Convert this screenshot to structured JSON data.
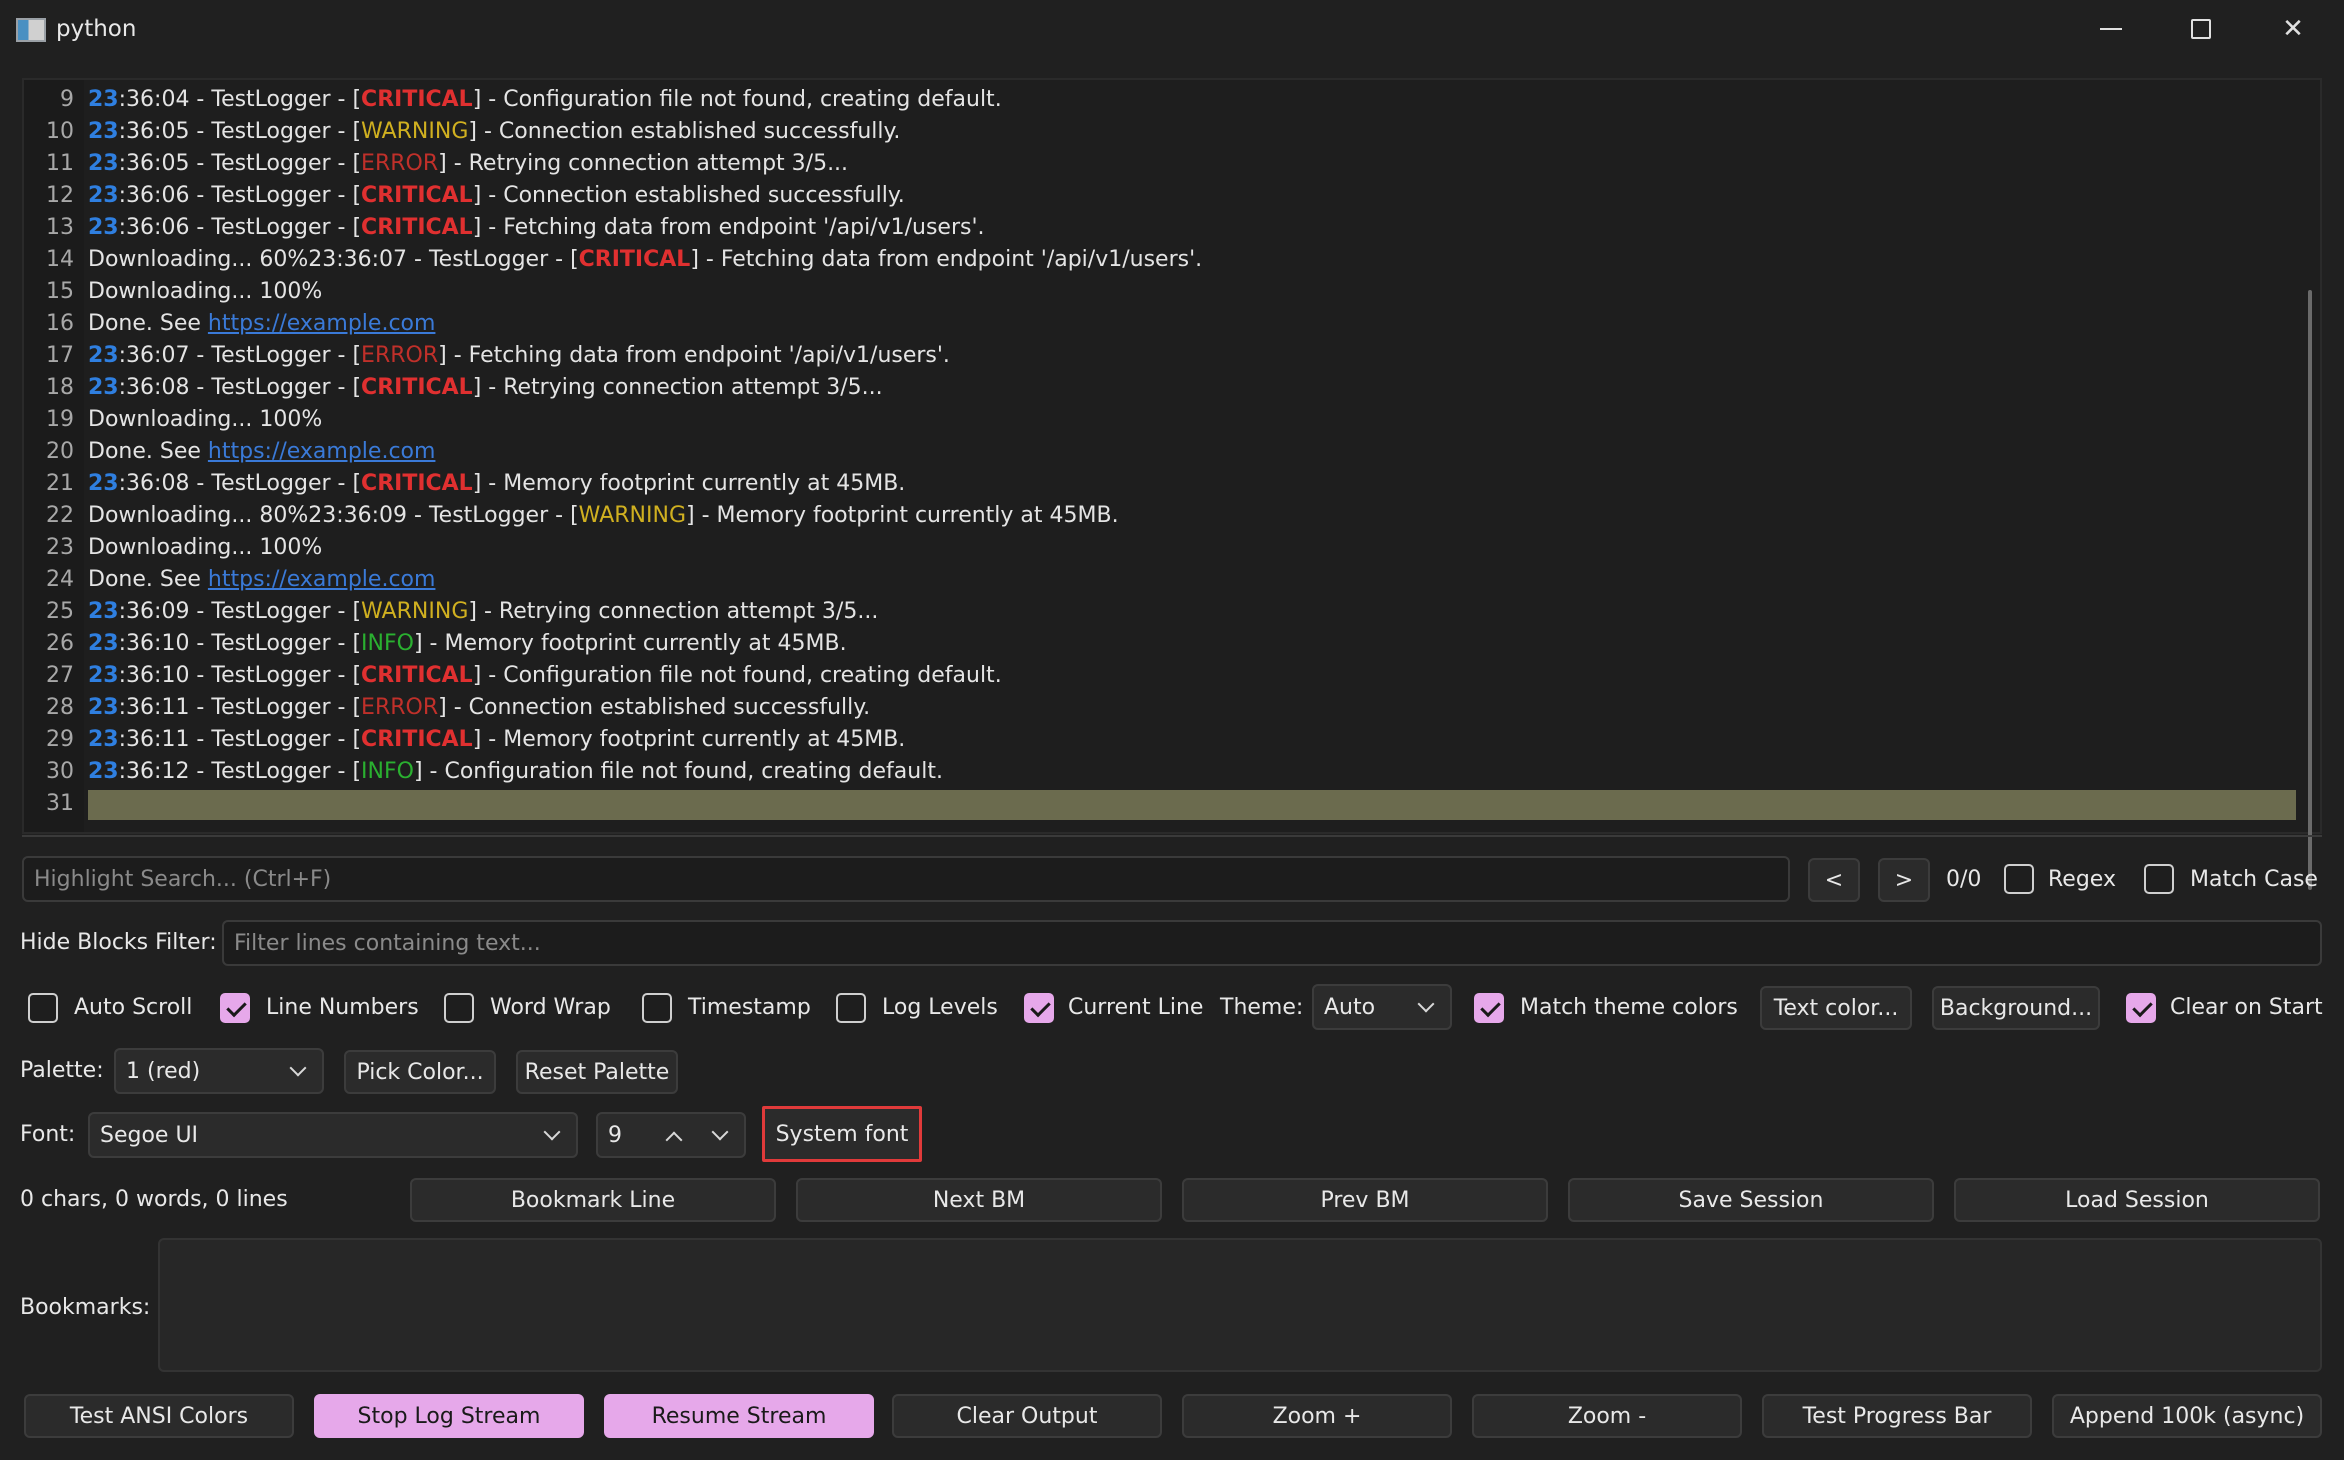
{
  "window": {
    "title": "python"
  },
  "log_lines": [
    {
      "n": "9",
      "parts": [
        [
          "ts",
          "23"
        ],
        [
          "t",
          ":36:04 - TestLogger - ["
        ],
        [
          "crit",
          "CRITICAL"
        ],
        [
          "t",
          "] - Configuration file not found, creating default."
        ]
      ]
    },
    {
      "n": "10",
      "parts": [
        [
          "ts",
          "23"
        ],
        [
          "t",
          ":36:05 - TestLogger - ["
        ],
        [
          "warn",
          "WARNING"
        ],
        [
          "t",
          "] - Connection established successfully."
        ]
      ]
    },
    {
      "n": "11",
      "parts": [
        [
          "ts",
          "23"
        ],
        [
          "t",
          ":36:05 - TestLogger - ["
        ],
        [
          "err",
          "ERROR"
        ],
        [
          "t",
          "] - Retrying connection attempt 3/5..."
        ]
      ]
    },
    {
      "n": "12",
      "parts": [
        [
          "ts",
          "23"
        ],
        [
          "t",
          ":36:06 - TestLogger - ["
        ],
        [
          "crit",
          "CRITICAL"
        ],
        [
          "t",
          "] - Connection established successfully."
        ]
      ]
    },
    {
      "n": "13",
      "parts": [
        [
          "ts",
          "23"
        ],
        [
          "t",
          ":36:06 - TestLogger - ["
        ],
        [
          "crit",
          "CRITICAL"
        ],
        [
          "t",
          "] - Fetching data from endpoint '/api/v1/users'."
        ]
      ]
    },
    {
      "n": "14",
      "parts": [
        [
          "t",
          "Downloading... 60%23:36:07 - TestLogger - ["
        ],
        [
          "crit",
          "CRITICAL"
        ],
        [
          "t",
          "] - Fetching data from endpoint '/api/v1/users'."
        ]
      ]
    },
    {
      "n": "15",
      "parts": [
        [
          "t",
          "Downloading... 100%"
        ]
      ]
    },
    {
      "n": "16",
      "parts": [
        [
          "t",
          "Done. See "
        ],
        [
          "link",
          "https://example.com"
        ]
      ]
    },
    {
      "n": "17",
      "parts": [
        [
          "ts",
          "23"
        ],
        [
          "t",
          ":36:07 - TestLogger - ["
        ],
        [
          "err",
          "ERROR"
        ],
        [
          "t",
          "] - Fetching data from endpoint '/api/v1/users'."
        ]
      ]
    },
    {
      "n": "18",
      "parts": [
        [
          "ts",
          "23"
        ],
        [
          "t",
          ":36:08 - TestLogger - ["
        ],
        [
          "crit",
          "CRITICAL"
        ],
        [
          "t",
          "] - Retrying connection attempt 3/5..."
        ]
      ]
    },
    {
      "n": "19",
      "parts": [
        [
          "t",
          "Downloading... 100%"
        ]
      ]
    },
    {
      "n": "20",
      "parts": [
        [
          "t",
          "Done. See "
        ],
        [
          "link",
          "https://example.com"
        ]
      ]
    },
    {
      "n": "21",
      "parts": [
        [
          "ts",
          "23"
        ],
        [
          "t",
          ":36:08 - TestLogger - ["
        ],
        [
          "crit",
          "CRITICAL"
        ],
        [
          "t",
          "] - Memory footprint currently at 45MB."
        ]
      ]
    },
    {
      "n": "22",
      "parts": [
        [
          "t",
          "Downloading... 80%23:36:09 - TestLogger - ["
        ],
        [
          "warn",
          "WARNING"
        ],
        [
          "t",
          "] - Memory footprint currently at 45MB."
        ]
      ]
    },
    {
      "n": "23",
      "parts": [
        [
          "t",
          "Downloading... 100%"
        ]
      ]
    },
    {
      "n": "24",
      "parts": [
        [
          "t",
          "Done. See "
        ],
        [
          "link",
          "https://example.com"
        ]
      ]
    },
    {
      "n": "25",
      "parts": [
        [
          "ts",
          "23"
        ],
        [
          "t",
          ":36:09 - TestLogger - ["
        ],
        [
          "warn",
          "WARNING"
        ],
        [
          "t",
          "] - Retrying connection attempt 3/5..."
        ]
      ]
    },
    {
      "n": "26",
      "parts": [
        [
          "ts",
          "23"
        ],
        [
          "t",
          ":36:10 - TestLogger - ["
        ],
        [
          "info",
          "INFO"
        ],
        [
          "t",
          "] - Memory footprint currently at 45MB."
        ]
      ]
    },
    {
      "n": "27",
      "parts": [
        [
          "ts",
          "23"
        ],
        [
          "t",
          ":36:10 - TestLogger - ["
        ],
        [
          "crit",
          "CRITICAL"
        ],
        [
          "t",
          "] - Configuration file not found, creating default."
        ]
      ]
    },
    {
      "n": "28",
      "parts": [
        [
          "ts",
          "23"
        ],
        [
          "t",
          ":36:11 - TestLogger - ["
        ],
        [
          "err",
          "ERROR"
        ],
        [
          "t",
          "] - Connection established successfully."
        ]
      ]
    },
    {
      "n": "29",
      "parts": [
        [
          "ts",
          "23"
        ],
        [
          "t",
          ":36:11 - TestLogger - ["
        ],
        [
          "crit",
          "CRITICAL"
        ],
        [
          "t",
          "] - Memory footprint currently at 45MB."
        ]
      ]
    },
    {
      "n": "30",
      "parts": [
        [
          "ts",
          "23"
        ],
        [
          "t",
          ":36:12 - TestLogger - ["
        ],
        [
          "info",
          "INFO"
        ],
        [
          "t",
          "] - Configuration file not found, creating default."
        ]
      ]
    },
    {
      "n": "31",
      "parts": [],
      "current": true
    }
  ],
  "search": {
    "placeholder": "Highlight Search... (Ctrl+F)",
    "prev_label": "<",
    "next_label": ">",
    "count": "0/0",
    "regex_label": "Regex",
    "match_case_label": "Match Case"
  },
  "filter": {
    "label": "Hide Blocks Filter:",
    "placeholder": "Filter lines containing text..."
  },
  "options": {
    "auto_scroll": "Auto Scroll",
    "line_numbers": "Line Numbers",
    "word_wrap": "Word Wrap",
    "timestamp": "Timestamp",
    "log_levels": "Log Levels",
    "current_line": "Current Line",
    "theme_label": "Theme:",
    "theme_value": "Auto",
    "match_theme": "Match theme colors",
    "text_color": "Text color...",
    "background": "Background...",
    "clear_on_start": "Clear on Start"
  },
  "palette": {
    "label": "Palette:",
    "value": "1 (red)",
    "pick": "Pick Color...",
    "reset": "Reset Palette"
  },
  "font": {
    "label": "Font:",
    "family": "Segoe UI",
    "size": "9",
    "system": "System font"
  },
  "stats": {
    "text": "0 chars, 0 words, 0 lines",
    "bookmark_line": "Bookmark Line",
    "next_bm": "Next BM",
    "prev_bm": "Prev BM",
    "save_session": "Save Session",
    "load_session": "Load Session"
  },
  "bookmarks": {
    "label": "Bookmarks:"
  },
  "bottom": {
    "test_ansi": "Test ANSI Colors",
    "stop_stream": "Stop Log Stream",
    "resume_stream": "Resume Stream",
    "clear_output": "Clear Output",
    "zoom_in": "Zoom +",
    "zoom_out": "Zoom -",
    "test_progress": "Test Progress Bar",
    "append": "Append 100k (async)"
  }
}
